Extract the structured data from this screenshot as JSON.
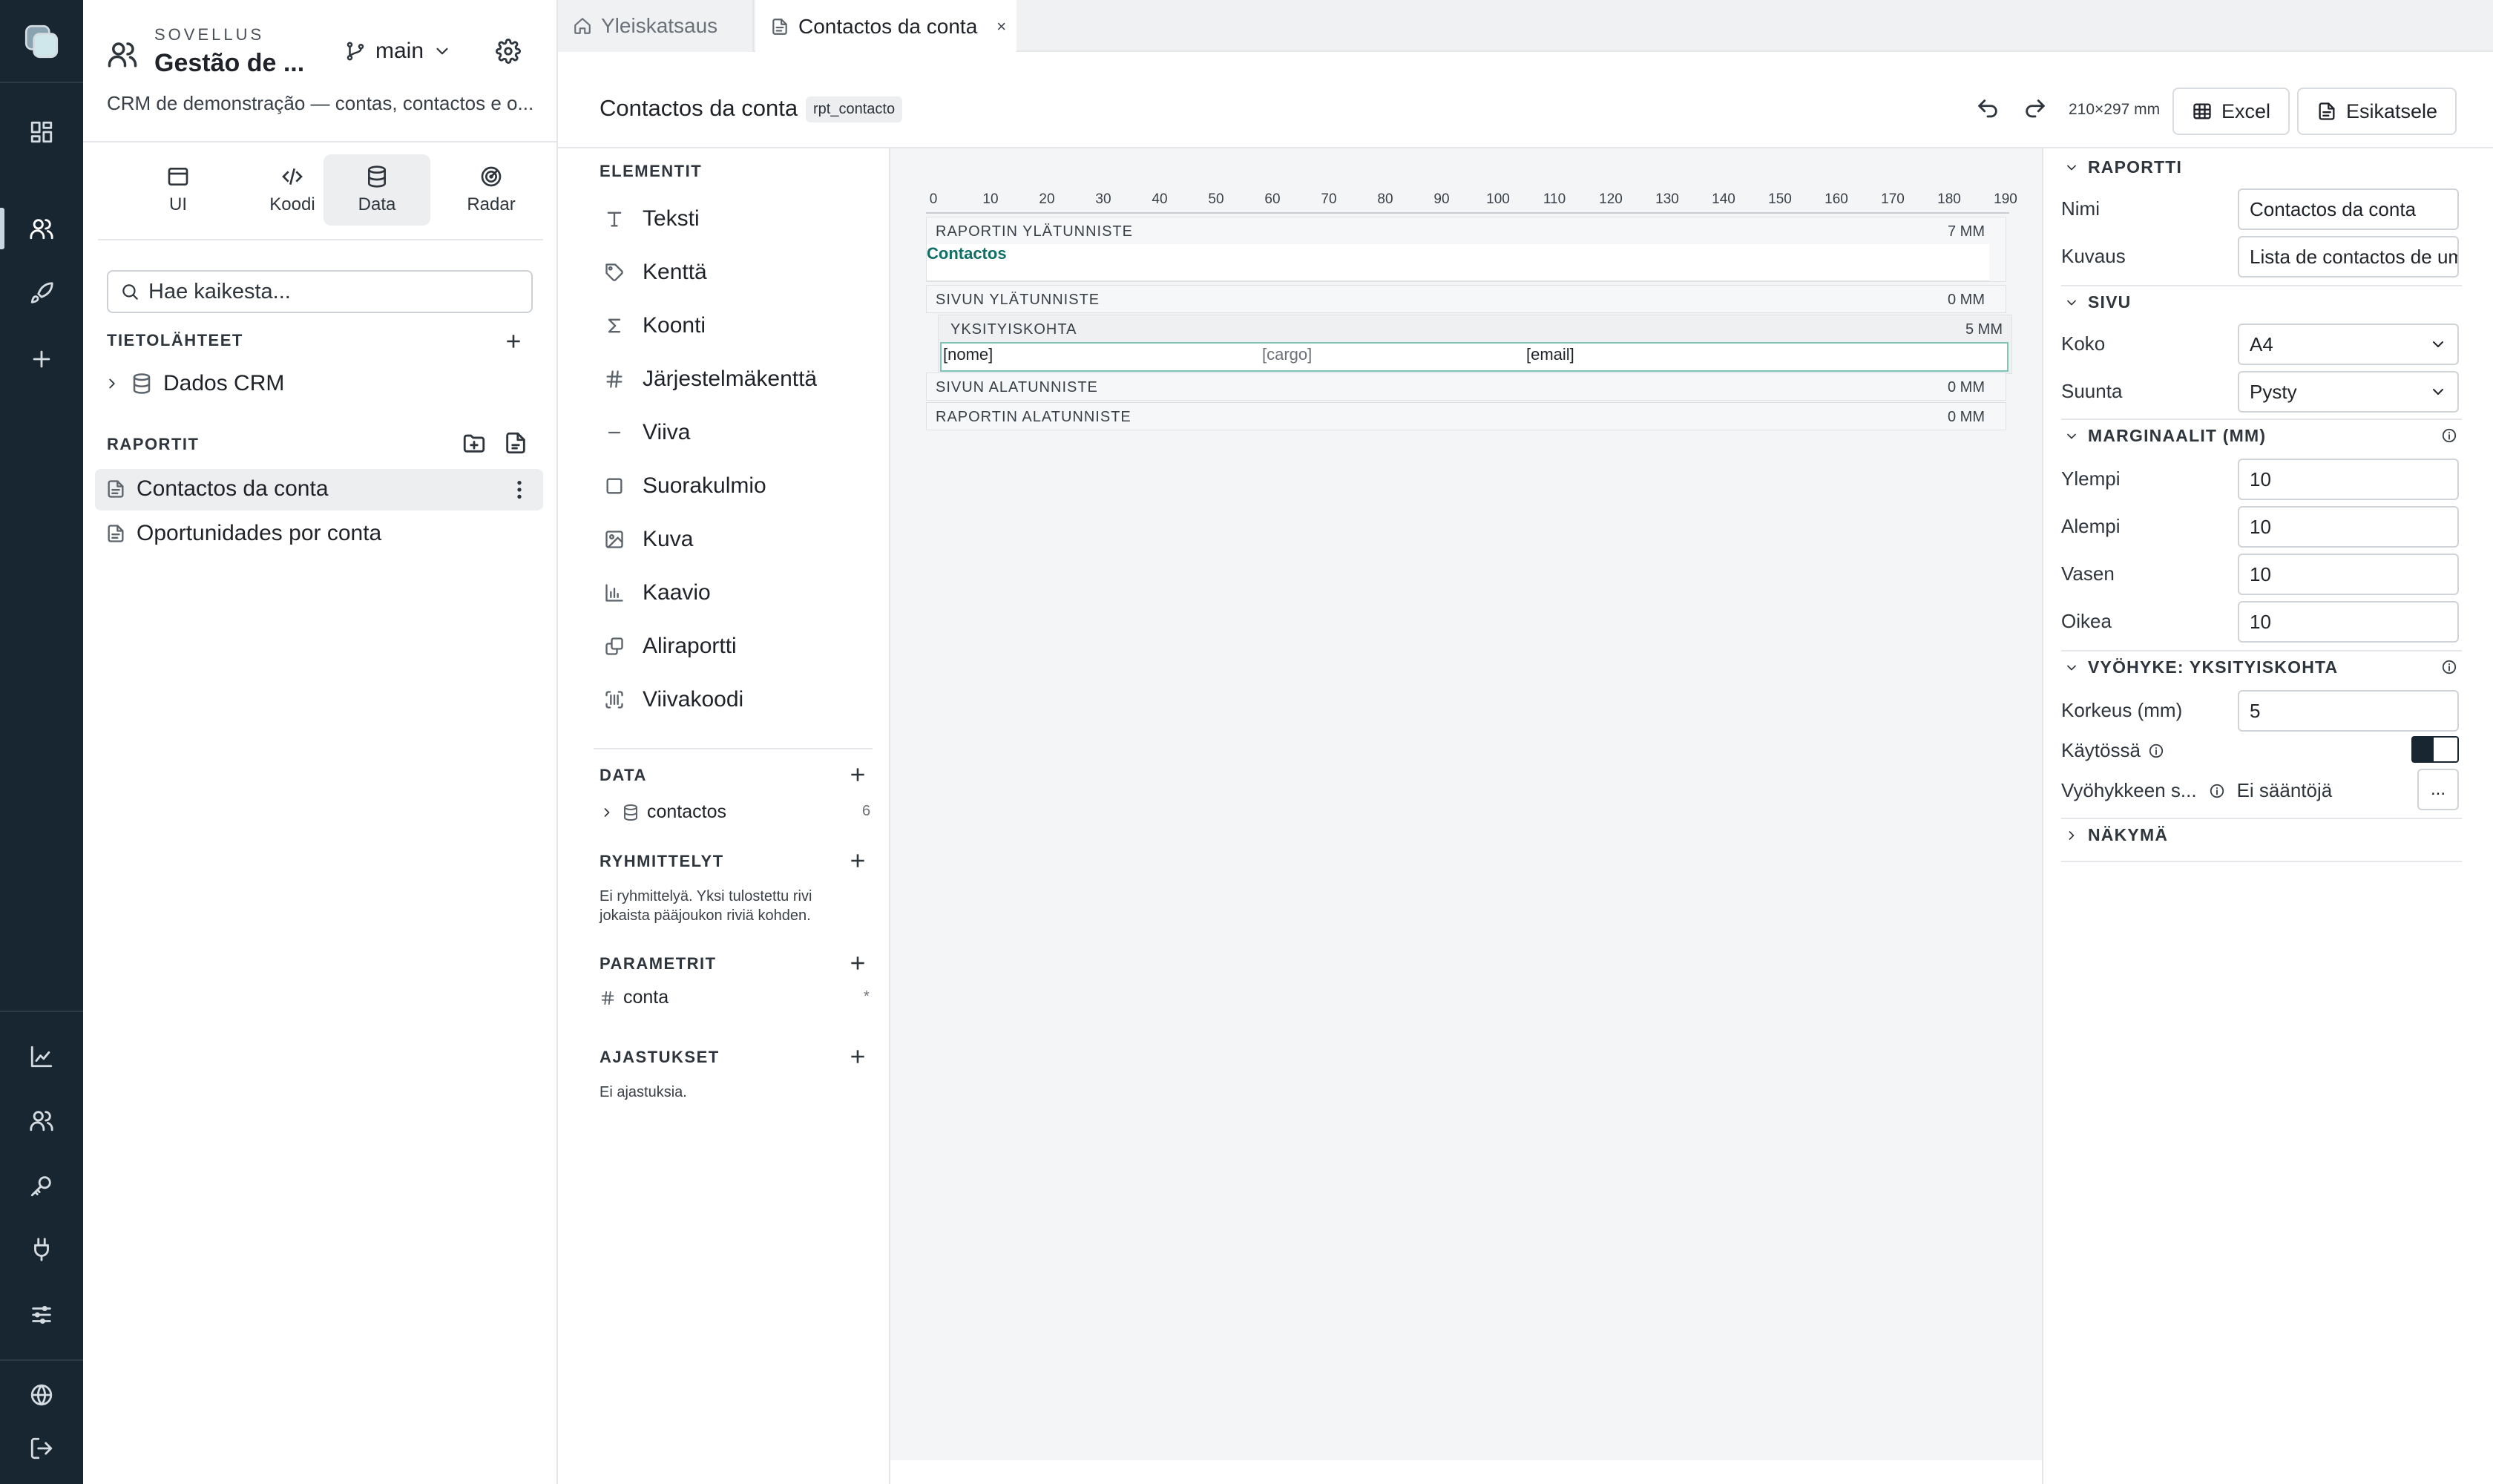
{
  "app": {
    "kicker": "SOVELLUS",
    "title": "Gestão de ...",
    "branch": "main",
    "description": "CRM de demonstração — contas, contactos e o..."
  },
  "modes": [
    {
      "label": "UI",
      "icon": "window-icon"
    },
    {
      "label": "Koodi",
      "icon": "code-icon"
    },
    {
      "label": "Data",
      "icon": "database-icon",
      "selected": true
    },
    {
      "label": "Radar",
      "icon": "radar-icon"
    }
  ],
  "search": {
    "placeholder": "Hae kaikesta..."
  },
  "datasources": {
    "header": "TIETOLÄHTEET",
    "items": [
      {
        "label": "Dados CRM"
      }
    ]
  },
  "reports": {
    "header": "RAPORTIT",
    "items": [
      {
        "label": "Contactos da conta",
        "selected": true
      },
      {
        "label": "Oportunidades por conta"
      }
    ]
  },
  "tabs": [
    {
      "label": "Yleiskatsaus",
      "active": false
    },
    {
      "label": "Contactos da conta",
      "active": true,
      "close": "×"
    }
  ],
  "toolbar": {
    "title": "Contactos da conta",
    "chip": "rpt_contacto",
    "page_size": "210×297 mm",
    "excel": "Excel",
    "preview": "Esikatsele"
  },
  "elements": {
    "header": "ELEMENTIT",
    "items": [
      "Teksti",
      "Kenttä",
      "Koonti",
      "Järjestelmäkenttä",
      "Viiva",
      "Suorakulmio",
      "Kuva",
      "Kaavio",
      "Aliraportti",
      "Viivakoodi"
    ],
    "data": {
      "header": "DATA",
      "item": "contactos",
      "count": "6"
    },
    "groups": {
      "header": "RYHMITTELYT",
      "text1": "Ei ryhmittelyä. Yksi tulostettu rivi",
      "text2": "jokaista pääjoukon riviä kohden."
    },
    "params": {
      "header": "PARAMETRIT",
      "item": "conta",
      "mark": "*"
    },
    "schedules": {
      "header": "AJASTUKSET",
      "text": "Ei ajastuksia."
    }
  },
  "canvas": {
    "ruler": [
      "0",
      "10",
      "20",
      "30",
      "40",
      "50",
      "60",
      "70",
      "80",
      "90",
      "100",
      "110",
      "120",
      "130",
      "140",
      "150",
      "160",
      "170",
      "180",
      "190"
    ],
    "bands": {
      "report_header": {
        "label": "RAPORTIN YLÄTUNNISTE",
        "mm": "7 MM",
        "text": "Contactos"
      },
      "page_header": {
        "label": "SIVUN YLÄTUNNISTE",
        "mm": "0 MM"
      },
      "detail": {
        "label": "YKSITYISKOHTA",
        "mm": "5 MM",
        "f1": "[nome]",
        "f2": "[cargo]",
        "f3": "[email]"
      },
      "page_footer": {
        "label": "SIVUN ALATUNNISTE",
        "mm": "0 MM"
      },
      "report_footer": {
        "label": "RAPORTIN ALATUNNISTE",
        "mm": "0 MM"
      }
    }
  },
  "props": {
    "report": {
      "header": "RAPORTTI",
      "name_label": "Nimi",
      "name": "Contactos da conta",
      "desc_label": "Kuvaus",
      "desc": "Lista de contactos de uma"
    },
    "page": {
      "header": "SIVU",
      "size_label": "Koko",
      "size": "A4",
      "orient_label": "Suunta",
      "orient": "Pysty"
    },
    "margins": {
      "header": "MARGINAALIT (MM)",
      "top_label": "Ylempi",
      "top": "10",
      "bottom_label": "Alempi",
      "bottom": "10",
      "left_label": "Vasen",
      "left": "10",
      "right_label": "Oikea",
      "right": "10"
    },
    "zone": {
      "header": "VYÖHYKE: YKSITYISKOHTA",
      "height_label": "Korkeus (mm)",
      "height": "5",
      "enabled_label": "Käytössä",
      "rules_label": "Vyöhykkeen s...",
      "rules_value": "Ei sääntöjä",
      "more": "..."
    },
    "view": {
      "header": "NÄKYMÄ"
    }
  },
  "colors": {
    "rail": "#172631",
    "accent": "#0f6e66",
    "detail_border": "#7fc2b6"
  }
}
